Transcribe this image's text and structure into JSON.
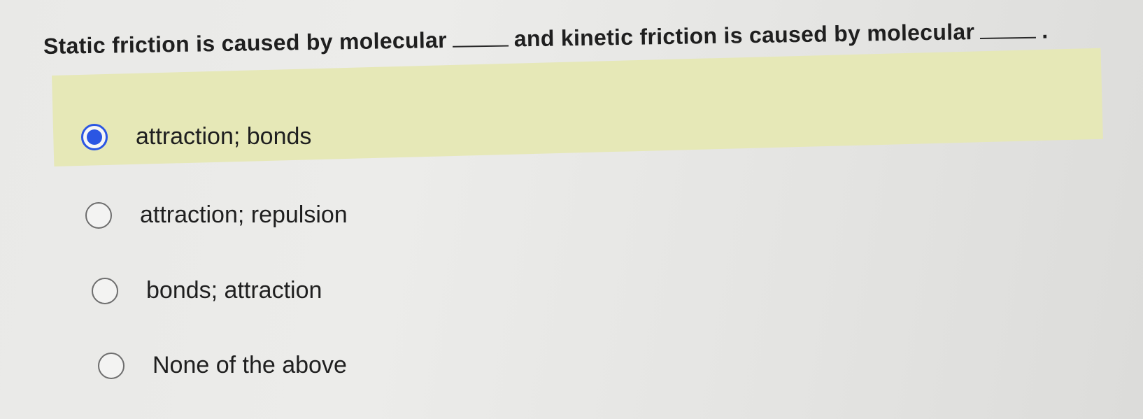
{
  "question": {
    "part1": "Static friction is caused by molecular",
    "part2": "and kinetic friction is caused by molecular",
    "part3": "."
  },
  "options": [
    {
      "label": "attraction; bonds",
      "selected": true
    },
    {
      "label": "attraction; repulsion",
      "selected": false
    },
    {
      "label": "bonds; attraction",
      "selected": false
    },
    {
      "label": "None of the above",
      "selected": false
    }
  ],
  "colors": {
    "accent": "#2b56e3",
    "highlight": "#e6e8b7",
    "background": "#e8e8e6"
  }
}
